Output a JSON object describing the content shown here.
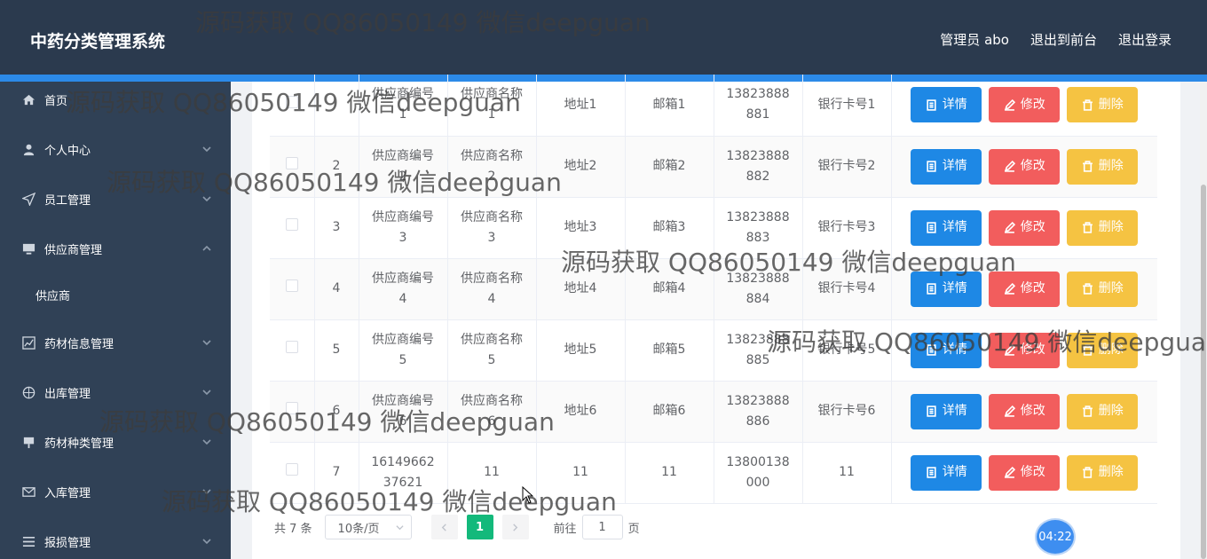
{
  "header": {
    "app_title": "中药分类管理系统",
    "nav": [
      "管理员 abo",
      "退出到前台",
      "退出登录"
    ]
  },
  "sidebar": {
    "items": [
      {
        "label": "首页",
        "icon": "home-icon"
      },
      {
        "label": "个人中心",
        "icon": "user-icon"
      },
      {
        "label": "员工管理",
        "icon": "send-icon"
      },
      {
        "label": "供应商管理",
        "icon": "monitor-icon"
      },
      {
        "label": "供应商",
        "icon": ""
      },
      {
        "label": "药材信息管理",
        "icon": "chart-icon"
      },
      {
        "label": "出库管理",
        "icon": "compass-icon"
      },
      {
        "label": "药材种类管理",
        "icon": "board-icon"
      },
      {
        "label": "入库管理",
        "icon": "mail-icon"
      },
      {
        "label": "报损管理",
        "icon": "list-icon"
      }
    ]
  },
  "table": {
    "rows": [
      {
        "idx": "",
        "code": [
          "供应商编号",
          "1"
        ],
        "name": [
          "供应商名称",
          "1"
        ],
        "address": "地址1",
        "email": "邮箱1",
        "phone": [
          "13823888",
          "881"
        ],
        "bank": "银行卡号1"
      },
      {
        "idx": "2",
        "code": [
          "供应商编号",
          "2"
        ],
        "name": [
          "供应商名称",
          "2"
        ],
        "address": "地址2",
        "email": "邮箱2",
        "phone": [
          "13823888",
          "882"
        ],
        "bank": "银行卡号2"
      },
      {
        "idx": "3",
        "code": [
          "供应商编号",
          "3"
        ],
        "name": [
          "供应商名称",
          "3"
        ],
        "address": "地址3",
        "email": "邮箱3",
        "phone": [
          "13823888",
          "883"
        ],
        "bank": "银行卡号3"
      },
      {
        "idx": "4",
        "code": [
          "供应商编号",
          "4"
        ],
        "name": [
          "供应商名称",
          "4"
        ],
        "address": "地址4",
        "email": "邮箱4",
        "phone": [
          "13823888",
          "884"
        ],
        "bank": "银行卡号4"
      },
      {
        "idx": "5",
        "code": [
          "供应商编号",
          "5"
        ],
        "name": [
          "供应商名称",
          "5"
        ],
        "address": "地址5",
        "email": "邮箱5",
        "phone": [
          "13823888",
          "885"
        ],
        "bank": "银行卡号5"
      },
      {
        "idx": "6",
        "code": [
          "供应商编号",
          "6"
        ],
        "name": [
          "供应商名称",
          "6"
        ],
        "address": "地址6",
        "email": "邮箱6",
        "phone": [
          "13823888",
          "886"
        ],
        "bank": "银行卡号6"
      },
      {
        "idx": "7",
        "code": [
          "16149662",
          "37621"
        ],
        "name": [
          "11",
          ""
        ],
        "address": "11",
        "email": "11",
        "phone": [
          "13800138",
          "000"
        ],
        "bank": "11"
      }
    ],
    "actions": {
      "detail": "详情",
      "edit": "修改",
      "delete": "删除"
    }
  },
  "pagination": {
    "total": "共 7 条",
    "page_size": "10条/页",
    "current_page": "1",
    "goto_label": "前往",
    "goto_value": "1",
    "page_suffix": "页"
  },
  "watermark_text": "源码获取 QQ86050149 微信deepguan",
  "timer": "04:22",
  "colors": {
    "header_bg": "#2b3a4e",
    "sidebar_bg": "#304156",
    "accent_blue": "#2c8ae8",
    "detail_btn": "#1e88e5",
    "edit_btn": "#f25d5d",
    "delete_btn": "#f5c342",
    "pager_active": "#13b97b"
  }
}
